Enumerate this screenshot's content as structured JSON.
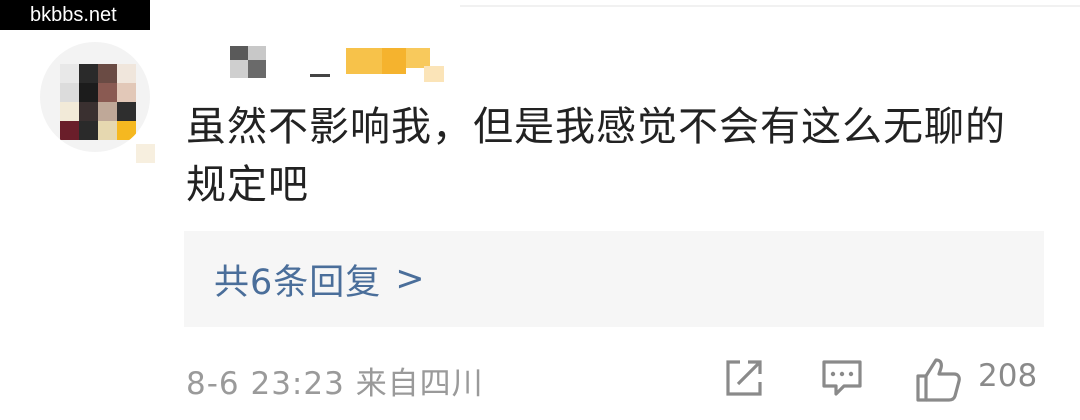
{
  "watermark": "bkbbs.net",
  "comment": {
    "text": "虽然不影响我，但是我感觉不会有这么无聊的规定吧",
    "replies_label": "共6条回复",
    "replies_chevron": ">",
    "timestamp": "8-6 23:23",
    "location": "来自四川",
    "like_count": "208"
  },
  "icons": {
    "share": "share-icon",
    "comment": "comment-icon",
    "like": "thumbs-up-icon"
  },
  "colors": {
    "link": "#4a6e9a",
    "text": "#222222",
    "meta": "#9a9a9a",
    "reply_box_bg": "#f6f6f6"
  }
}
